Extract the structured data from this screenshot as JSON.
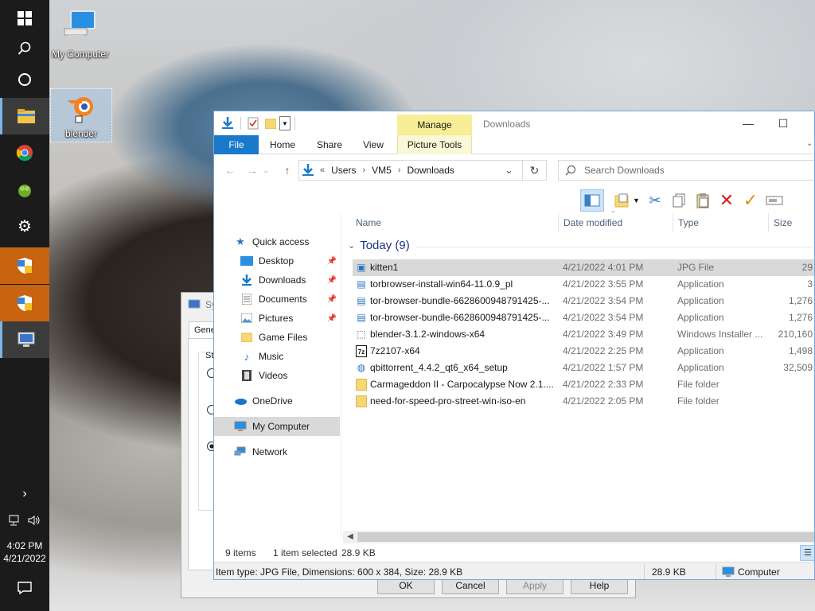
{
  "desktop": {
    "icons": [
      {
        "label": "My Computer"
      },
      {
        "label": "blender"
      }
    ]
  },
  "taskbar": {
    "time": "4:02 PM",
    "date": "4/21/2022"
  },
  "system_dialog": {
    "title": "Sy",
    "tab": "Gener",
    "section": "Sta",
    "buttons": {
      "ok": "OK",
      "cancel": "Cancel",
      "apply": "Apply",
      "help": "Help"
    }
  },
  "explorer": {
    "title": "Downloads",
    "manage_tab": "Manage",
    "ribbon_tabs": [
      "File",
      "Home",
      "Share",
      "View",
      "Picture Tools"
    ],
    "address": {
      "crumbs": [
        "Users",
        "VM5",
        "Downloads"
      ],
      "overflow": "«"
    },
    "search_placeholder": "Search Downloads",
    "nav": {
      "quick_access": "Quick access",
      "items": [
        "Desktop",
        "Downloads",
        "Documents",
        "Pictures",
        "Game Files",
        "Music",
        "Videos"
      ],
      "onedrive": "OneDrive",
      "my_computer": "My Computer",
      "network": "Network"
    },
    "columns": {
      "name": "Name",
      "date": "Date modified",
      "type": "Type",
      "size": "Size"
    },
    "group": "Today (9)",
    "files": [
      {
        "name": "kitten1",
        "date": "4/21/2022 4:01 PM",
        "type": "JPG File",
        "size": "29",
        "icon": "image-file-icon"
      },
      {
        "name": "torbrowser-install-win64-11.0.9_pl",
        "date": "4/21/2022 3:55 PM",
        "type": "Application",
        "size": "3",
        "icon": "app-icon"
      },
      {
        "name": "tor-browser-bundle-6628600948791425-...",
        "date": "4/21/2022 3:54 PM",
        "type": "Application",
        "size": "1,276",
        "icon": "app-icon"
      },
      {
        "name": "tor-browser-bundle-6628600948791425-...",
        "date": "4/21/2022 3:54 PM",
        "type": "Application",
        "size": "1,276",
        "icon": "app-icon"
      },
      {
        "name": "blender-3.1.2-windows-x64",
        "date": "4/21/2022 3:49 PM",
        "type": "Windows Installer ...",
        "size": "210,160",
        "icon": "installer-icon"
      },
      {
        "name": "7z2107-x64",
        "date": "4/21/2022 2:25 PM",
        "type": "Application",
        "size": "1,498",
        "icon": "7zip-icon"
      },
      {
        "name": "qbittorrent_4.4.2_qt6_x64_setup",
        "date": "4/21/2022 1:57 PM",
        "type": "Application",
        "size": "32,509",
        "icon": "qbittorrent-icon"
      },
      {
        "name": "Carmageddon II - Carpocalypse Now 2.1....",
        "date": "4/21/2022 2:33 PM",
        "type": "File folder",
        "size": "",
        "icon": "folder-icon"
      },
      {
        "name": "need-for-speed-pro-street-win-iso-en",
        "date": "4/21/2022 2:05 PM",
        "type": "File folder",
        "size": "",
        "icon": "folder-icon"
      }
    ],
    "status": {
      "items": "9 items",
      "selected": "1 item selected",
      "size": "28.9 KB"
    },
    "info": {
      "details": "Item type: JPG File, Dimensions: 600 x 384, Size: 28.9 KB",
      "size": "28.9 KB",
      "location": "Computer"
    }
  }
}
